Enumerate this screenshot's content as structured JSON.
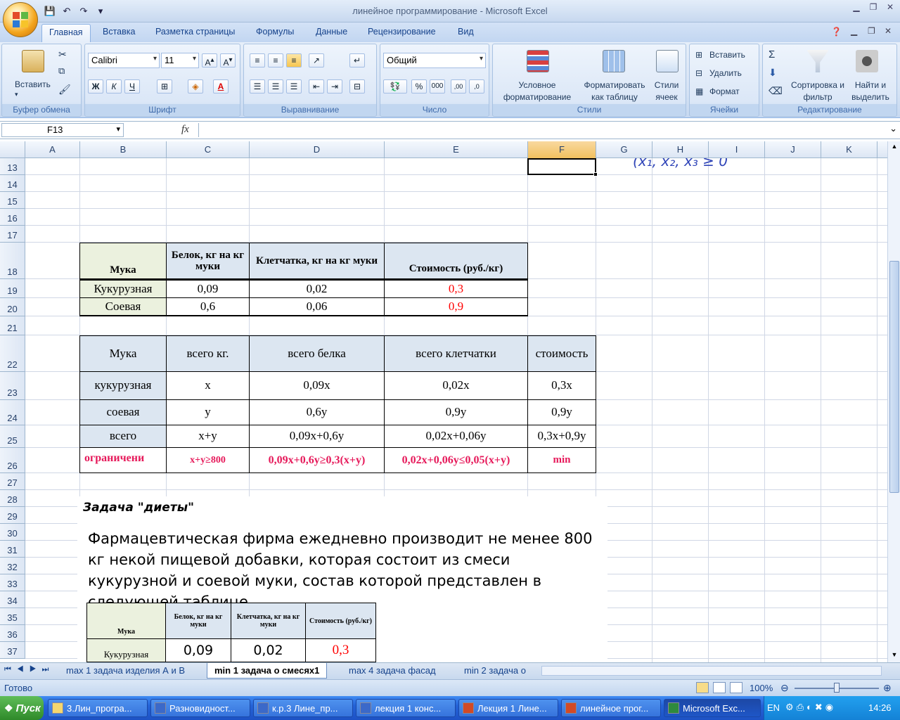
{
  "window": {
    "title": "линейное программирование - Microsoft Excel"
  },
  "ribbon": {
    "tabs": [
      "Главная",
      "Вставка",
      "Разметка страницы",
      "Формулы",
      "Данные",
      "Рецензирование",
      "Вид"
    ],
    "clipboard": {
      "paste": "Вставить",
      "label": "Буфер обмена"
    },
    "font": {
      "name": "Calibri",
      "size": "11",
      "bold": "Ж",
      "italic": "К",
      "underline": "Ч",
      "label": "Шрифт"
    },
    "align": {
      "label": "Выравнивание"
    },
    "number": {
      "format": "Общий",
      "label": "Число"
    },
    "styles": {
      "cond": "Условное форматирование",
      "table": "Форматировать как таблицу",
      "cell": "Стили ячеек",
      "label": "Стили"
    },
    "cells": {
      "insert": "Вставить",
      "delete": "Удалить",
      "format": "Формат",
      "label": "Ячейки"
    },
    "edit": {
      "sort": "Сортировка и фильтр",
      "find": "Найти и выделить",
      "label": "Редактирование"
    }
  },
  "formula_bar": {
    "name_box": "F13",
    "fx": "fx",
    "content": ""
  },
  "columns": [
    "A",
    "B",
    "C",
    "D",
    "E",
    "F",
    "G",
    "H",
    "I",
    "J",
    "K"
  ],
  "rows": [
    "13",
    "14",
    "15",
    "16",
    "17",
    "18",
    "19",
    "20",
    "21",
    "22",
    "23",
    "24",
    "25",
    "26",
    "27",
    "28",
    "29",
    "30",
    "31",
    "32",
    "33",
    "34",
    "35",
    "36",
    "37"
  ],
  "handwriting": "(x₁, x₂, x₃ ≥ 0",
  "table1": {
    "headers": [
      "Мука",
      "Белок, кг на кг муки",
      "Клетчатка, кг на кг муки",
      "Стоимость (руб./кг)"
    ],
    "rows": [
      [
        "Кукурузная",
        "0,09",
        "0,02",
        "0,3"
      ],
      [
        "Соевая",
        "0,6",
        "0,06",
        "0,9"
      ]
    ]
  },
  "table2": {
    "headers": [
      "Мука",
      "всего кг.",
      "всего белка",
      "всего клетчатки",
      "стоимость"
    ],
    "rows": [
      [
        "кукурузная",
        "x",
        "0,09x",
        "0,02x",
        "0,3x"
      ],
      [
        "соевая",
        "y",
        "0,6y",
        "0,9y",
        "0,9y"
      ],
      [
        "всего",
        "x+y",
        "0,09x+0,6y",
        "0,02x+0,06y",
        "0,3x+0,9y"
      ]
    ],
    "constraints": [
      "ограничени",
      "x+y≥800",
      "0,09x+0,6y≥0,3(x+y)",
      "0,02x+0,06y≤0,05(x+y)",
      "min"
    ]
  },
  "picture": {
    "title": "Задача \"диеты\"",
    "text": "Фармацевтическая фирма ежедневно производит не менее 800 кг некой пищевой добавки, которая состоит из смеси кукурузной и соевой муки, состав которой представлен в следующей таблице",
    "table": {
      "headers": [
        "Мука",
        "Белок, кг на кг муки",
        "Клетчатка, кг на кг муки",
        "Стоимость (руб./кг)"
      ],
      "row": [
        "Кукурузная",
        "0,09",
        "0,02",
        "0,3"
      ]
    }
  },
  "sheets": [
    "max 1 задача изделия А и В",
    "min 1 задача о смесях1",
    "max 4 задача фасад",
    "min 2 задача о"
  ],
  "status": {
    "ready": "Готово",
    "zoom": "100%"
  },
  "taskbar": {
    "start": "Пуск",
    "items": [
      "3.Лин_програ...",
      "Разновидност...",
      "к.р.3 Лине_пр...",
      "лекция 1 конс...",
      "Лекция 1 Лине...",
      "линейное прог...",
      "Microsoft Exc..."
    ],
    "lang": "EN",
    "clock": "14:26"
  },
  "colors": {
    "red": "#ff0000",
    "pink": "#e6195a",
    "header_blue": "#dce6f1",
    "header_green": "#ebf1de"
  }
}
